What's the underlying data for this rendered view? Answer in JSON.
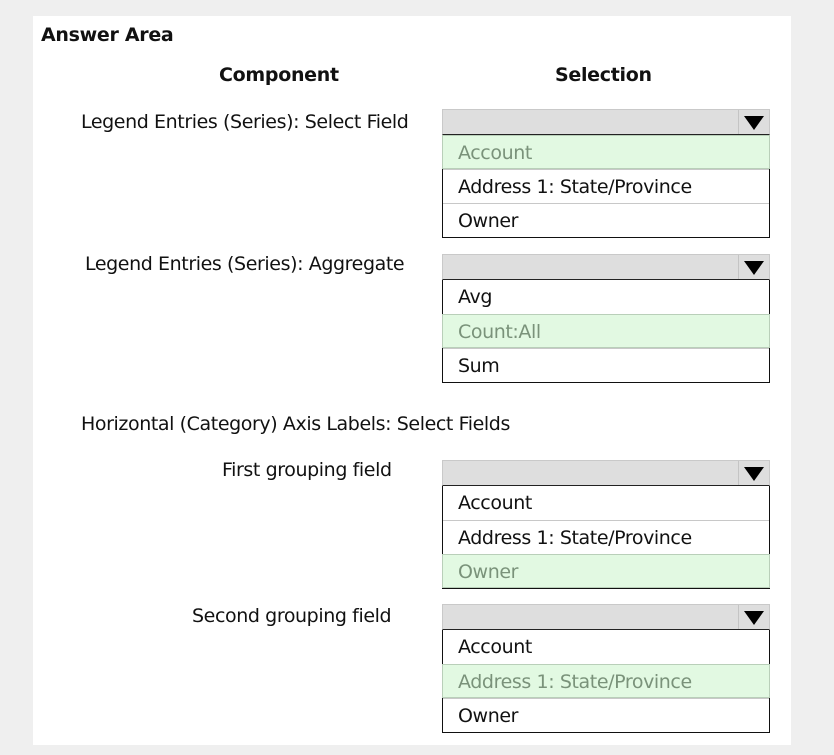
{
  "title": "Answer Area",
  "headers": {
    "component": "Component",
    "selection": "Selection"
  },
  "section_label": "Horizontal (Category) Axis Labels: Select Fields",
  "rows": [
    {
      "label": "Legend Entries (Series): Select Field",
      "options": [
        "Account",
        "Address 1: State/Province",
        "Owner"
      ],
      "selected_index": 0
    },
    {
      "label": "Legend Entries (Series): Aggregate",
      "options": [
        "Avg",
        "Count:All",
        "Sum"
      ],
      "selected_index": 1
    },
    {
      "label": "First grouping field",
      "options": [
        "Account",
        "Address 1: State/Province",
        "Owner"
      ],
      "selected_index": 2
    },
    {
      "label": "Second grouping field",
      "options": [
        "Account",
        "Address 1: State/Province",
        "Owner"
      ],
      "selected_index": 1
    }
  ],
  "icons": {
    "dropdown_arrow": "triangle-down"
  },
  "colors": {
    "selected_bg": "#e2f9e2",
    "selected_text": "#7a927a",
    "header_bg": "#dedede",
    "page_bg": "#efefef"
  }
}
